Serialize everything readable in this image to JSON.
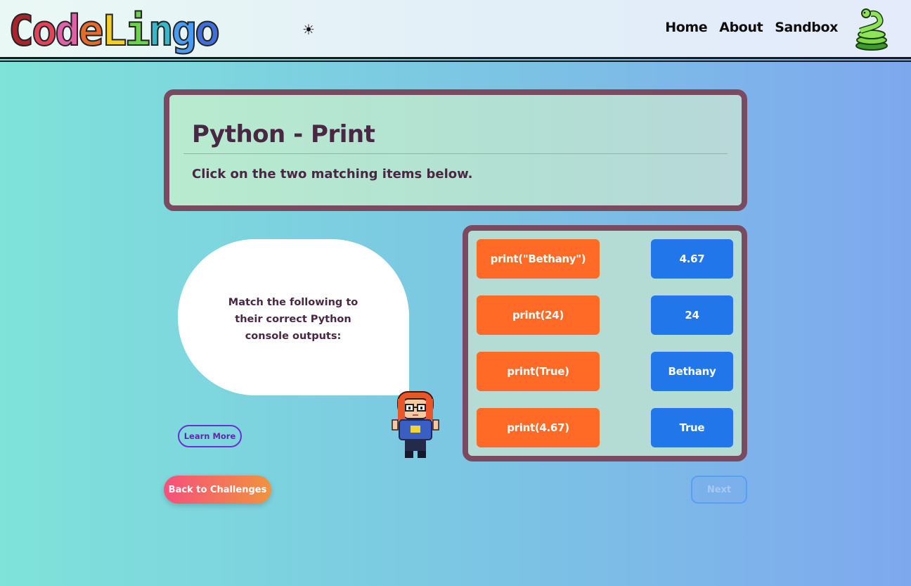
{
  "header": {
    "logo_letters": [
      "C",
      "o",
      "d",
      "e",
      "L",
      "i",
      "n",
      "g",
      "o"
    ],
    "logo_colors": [
      "#a8242c",
      "#e0435a",
      "#df62a8",
      "#e66a2c",
      "#f4ce2b",
      "#69d34b",
      "#3ab6c9",
      "#4a9af0",
      "#3f6ed8"
    ],
    "theme_icon": "☀",
    "nav": {
      "home": "Home",
      "about": "About",
      "sandbox": "Sandbox"
    }
  },
  "lesson": {
    "title": "Python - Print",
    "instruction": "Click on the two matching items below."
  },
  "bubble": {
    "text": "Match the following to their correct Python console outputs:"
  },
  "buttons": {
    "learn_more": "Learn More",
    "back": "Back to Challenges",
    "next": "Next"
  },
  "match": {
    "left": [
      "print(\"Bethany\")",
      "print(24)",
      "print(True)",
      "print(4.67)"
    ],
    "right": [
      "4.67",
      "24",
      "Bethany",
      "True"
    ]
  },
  "colors": {
    "left_tile": "#ff6a26",
    "right_tile": "#2177ea",
    "panel_border": "#7a4b60"
  }
}
